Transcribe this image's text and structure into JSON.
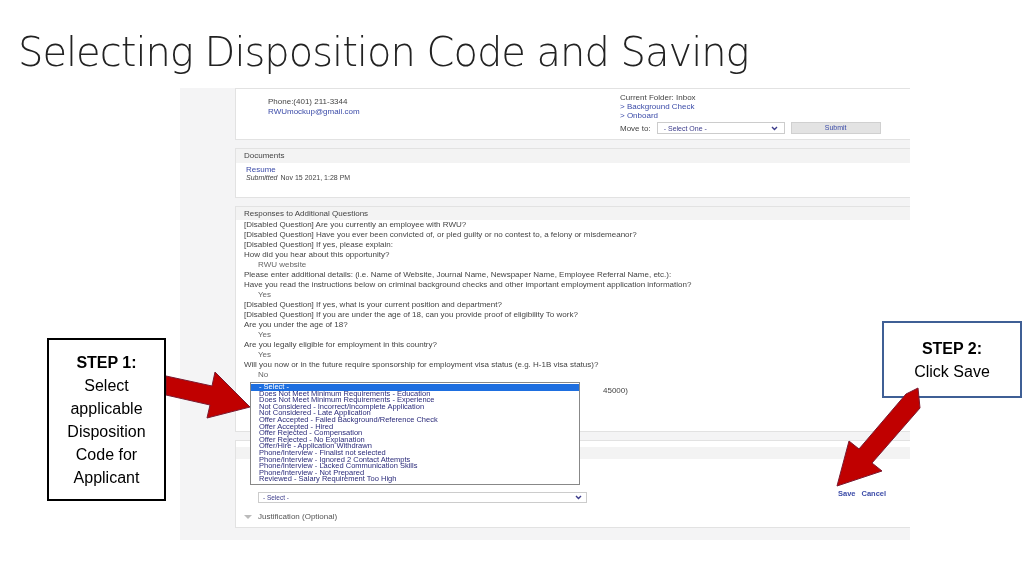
{
  "title": "Selecting Disposition Code and Saving",
  "callouts": [
    {
      "heading": "STEP 1:",
      "text": "Select applicable Disposition Code for Applicant"
    },
    {
      "heading": "STEP 2:",
      "text": "Click Save"
    }
  ],
  "screenshot": {
    "contact": {
      "phone": "Phone:(401) 211-3344",
      "email": "RWUmockup@gmail.com"
    },
    "folder": {
      "current": "Current Folder: Inbox",
      "links": [
        "> Background Check",
        "> Onboard"
      ],
      "move_label": "Move to:",
      "move_select": "- Select One -",
      "submit": "Submit"
    },
    "documents": {
      "heading": "Documents",
      "link": "Resume",
      "submitted_label": "Submitted",
      "submitted_date": "Nov 15 2021, 1:28 PM"
    },
    "responses": {
      "heading": "Responses to Additional Questions",
      "items": [
        {
          "kind": "question",
          "text": "[Disabled Question] Are you currently an employee with RWU?"
        },
        {
          "kind": "question",
          "text": "[Disabled Question] Have you ever been convicted of, or pled guilty or no contest to, a felony or misdemeanor?"
        },
        {
          "kind": "question",
          "text": "[Disabled Question] If yes, please explain:"
        },
        {
          "kind": "question",
          "text": "How did you hear about this opportunity?"
        },
        {
          "kind": "answer",
          "text": "RWU website"
        },
        {
          "kind": "question",
          "text": "Please enter additional details: (i.e. Name of Website, Journal Name, Newspaper Name, Employee Referral Name, etc.):"
        },
        {
          "kind": "question",
          "text": "Have you read the instructions below on criminal background checks and other important employment application information?"
        },
        {
          "kind": "answer",
          "text": "Yes"
        },
        {
          "kind": "question",
          "text": "[Disabled Question] If yes, what is your current position and department?"
        },
        {
          "kind": "question",
          "text": "[Disabled Question] If you are under the age of 18, can you provide proof of eligibility To work?"
        },
        {
          "kind": "question",
          "text": "Are you under the age of 18?"
        },
        {
          "kind": "answer",
          "text": "Yes"
        },
        {
          "kind": "question",
          "text": "Are you legally eligible for employment in this country?"
        },
        {
          "kind": "answer",
          "text": "Yes"
        },
        {
          "kind": "question",
          "text": "Will you now or in the future require sponsorship for employment visa status (e.g. H-1B visa status)?"
        },
        {
          "kind": "answer",
          "text": "No"
        }
      ],
      "covered_tail": "45000)"
    },
    "disposition": {
      "options": [
        {
          "label": "- Select -",
          "selected": true
        },
        {
          "label": "Does Not Meet Minimum Requirements - Education",
          "selected": false
        },
        {
          "label": "Does Not Meet Minimum Requirements - Experience",
          "selected": false
        },
        {
          "label": "Not Considered - Incorrect/Incomplete Application",
          "selected": false
        },
        {
          "label": "Not Considered - Late Application",
          "selected": false
        },
        {
          "label": "Offer Accepted - Failed Background/Reference Check",
          "selected": false
        },
        {
          "label": "Offer Accepted - Hired",
          "selected": false
        },
        {
          "label": "Offer Rejected - Compensation",
          "selected": false
        },
        {
          "label": "Offer Rejected - No Explanation",
          "selected": false
        },
        {
          "label": "Offer/Hire - Application Withdrawn",
          "selected": false
        },
        {
          "label": "Phone/Interview - Finalist not selected",
          "selected": false
        },
        {
          "label": "Phone/Interview - Ignored 2 Contact Attempts",
          "selected": false
        },
        {
          "label": "Phone/Interview - Lacked Communication Skills",
          "selected": false
        },
        {
          "label": "Phone/Interview - Not Prepared",
          "selected": false
        },
        {
          "label": "Reviewed - Salary Requirement Too High",
          "selected": false
        }
      ],
      "select_value": "- Select -",
      "actions": [
        "Save",
        "Cancel"
      ],
      "justification": "Justification (Optional)"
    }
  }
}
